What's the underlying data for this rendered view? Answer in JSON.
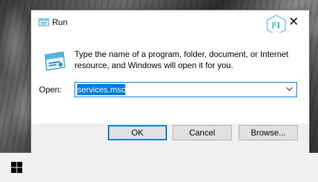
{
  "dialog": {
    "title": "Run",
    "description": "Type the name of a program, folder, document, or Internet resource, and Windows will open it for you.",
    "open_label": "Open:",
    "open_value": "services.msc",
    "buttons": {
      "ok": "OK",
      "cancel": "Cancel",
      "browse": "Browse..."
    },
    "close_glyph": "✕"
  },
  "icons": {
    "title": "run-app-icon",
    "large": "run-app-icon",
    "close": "close-icon",
    "dropdown": "chevron-down-icon",
    "watermark": "site-logo",
    "start": "windows-logo-icon"
  },
  "colors": {
    "accent": "#0078d7",
    "dialog_client": "#ffffff",
    "dialog_footer": "#f0f0f0",
    "taskbar": "#f1f1f1"
  }
}
